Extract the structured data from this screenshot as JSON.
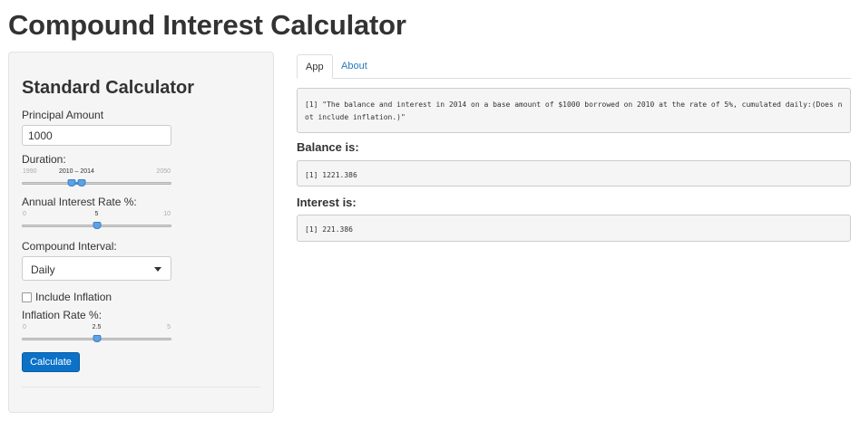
{
  "title": "Compound Interest Calculator",
  "sidebar": {
    "heading": "Standard Calculator",
    "principal": {
      "label": "Principal Amount",
      "value": "1000"
    },
    "duration": {
      "label": "Duration:",
      "min": "1990",
      "max": "2050",
      "current": "2010 – 2014",
      "range_start_fraction": 0.333,
      "range_end_fraction": 0.4
    },
    "rate": {
      "label": "Annual Interest Rate %:",
      "min": "0",
      "max": "10",
      "current": "5",
      "fraction": 0.5
    },
    "compound": {
      "label": "Compound Interval:",
      "selected": "Daily"
    },
    "inflation_checkbox": {
      "label": "Include Inflation",
      "checked": false
    },
    "inflation_rate": {
      "label": "Inflation Rate %:",
      "min": "0",
      "max": "5",
      "current": "2.5",
      "fraction": 0.5
    },
    "calculate_label": "Calculate"
  },
  "tabs": [
    {
      "label": "App",
      "active": true
    },
    {
      "label": "About",
      "active": false
    }
  ],
  "output": {
    "summary": "[1] \"The balance and interest in 2014 on a base amount of $1000 borrowed on 2010 at the rate of 5%, cumulated daily:(Does not include inflation.)\"",
    "balance_heading": "Balance is:",
    "balance_value": "[1] 1221.386",
    "interest_heading": "Interest is:",
    "interest_value": "[1] 221.386"
  },
  "colors": {
    "accent": "#0b72c8",
    "link": "#2a7ab9",
    "slider_handle": "#5ba3e6"
  }
}
